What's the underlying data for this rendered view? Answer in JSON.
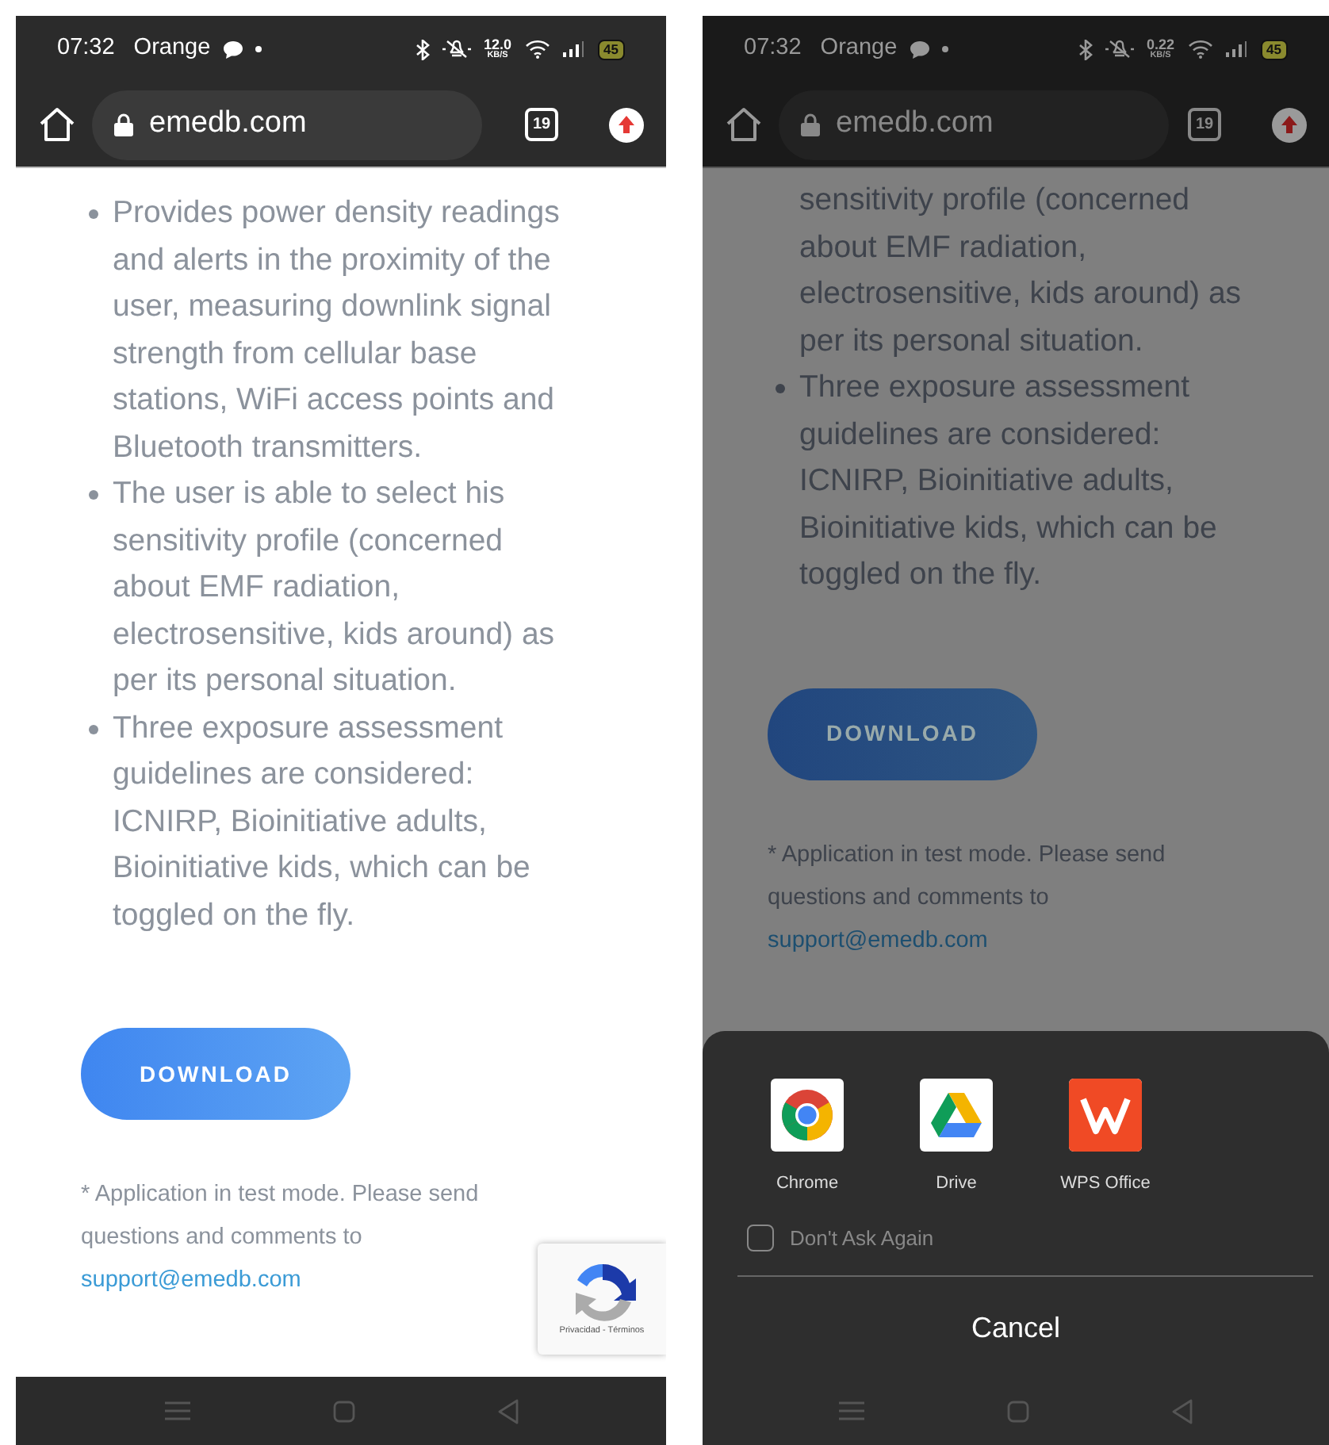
{
  "screens": [
    {
      "dimmed": false,
      "status_bar": {
        "time": "07:32",
        "carrier": "Orange",
        "speed": "12.0",
        "speed_unit": "KB/S",
        "battery": "45"
      },
      "browser": {
        "url": "emedb.com",
        "tab_count": "19"
      },
      "content": {
        "items": [
          {
            "kind": "bullet",
            "text": "Provides power density readings and alerts in the proximity of the user, measuring downlink signal strength from cellular base stations, WiFi access points and Bluetooth transmitters."
          },
          {
            "kind": "bullet",
            "text": "The user is able to select his sensitivity profile (concerned about EMF radiation, electrosensitive, kids around) as per its personal situation."
          },
          {
            "kind": "bullet",
            "text": "Three exposure assessment guidelines are considered: ICNIRP, Bioinitiative adults, Bioinitiative kids, which can be toggled on the fly."
          }
        ],
        "download_button": "DOWNLOAD",
        "note": "* Application in test mode. Please send questions and comments to",
        "email": "support@emedb.com"
      },
      "recaptcha": {
        "text": "Privacidad - Términos"
      }
    },
    {
      "dimmed": true,
      "status_bar": {
        "time": "07:32",
        "carrier": "Orange",
        "speed": "0.22",
        "speed_unit": "KB/S",
        "battery": "45"
      },
      "browser": {
        "url": "emedb.com",
        "tab_count": "19"
      },
      "content": {
        "items": [
          {
            "kind": "continuation",
            "text": "sensitivity profile (concerned about EMF radiation, electrosensitive, kids around) as per its personal situation."
          },
          {
            "kind": "bullet",
            "text": "Three exposure assessment guidelines are considered: ICNIRP, Bioinitiative adults, Bioinitiative kids, which can be toggled on the fly."
          }
        ],
        "download_button": "DOWNLOAD",
        "note": "* Application in test mode. Please send questions and comments to",
        "email": "support@emedb.com"
      },
      "share_sheet": {
        "apps": [
          {
            "kind": "chrome",
            "name": "Chrome"
          },
          {
            "kind": "drive",
            "name": "Drive"
          },
          {
            "kind": "wps",
            "name": "WPS Office"
          }
        ],
        "dont_ask_again": {
          "label": "Don't Ask Again",
          "checked": false
        },
        "cancel": "Cancel"
      }
    }
  ]
}
